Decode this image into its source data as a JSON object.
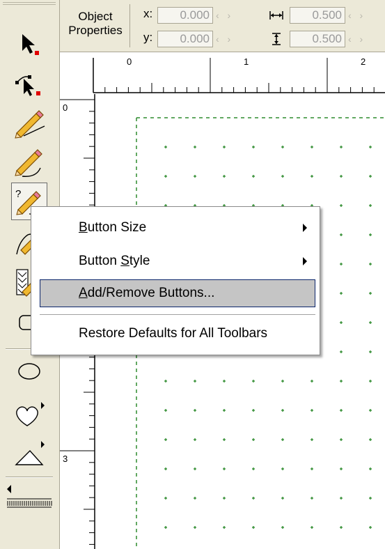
{
  "properties": {
    "title_line1": "Object",
    "title_line2": "Properties",
    "x_label": "x:",
    "y_label": "y:",
    "x_value": "0.000",
    "y_value": "0.000",
    "width_value": "0.500",
    "height_value": "0.500",
    "spin_glyph": "‹ ›"
  },
  "ruler": {
    "h_labels": [
      "0",
      "1",
      "2"
    ],
    "v_labels": [
      "0",
      "3"
    ]
  },
  "tools": [
    {
      "name": "select-tool",
      "icon": "arrow-pointer-icon"
    },
    {
      "name": "node-edit-tool",
      "icon": "node-arrow-icon"
    },
    {
      "name": "freehand-tool",
      "icon": "pencil-line-icon"
    },
    {
      "name": "bezier-tool",
      "icon": "pencil-curve-icon"
    },
    {
      "name": "pen-tool",
      "icon": "pencil-question-icon"
    },
    {
      "name": "calligraphy-tool",
      "icon": "pencil-brush-icon"
    },
    {
      "name": "pattern-tool",
      "icon": "pencil-pattern-icon"
    },
    {
      "name": "rectangle-tool",
      "icon": "rounded-rectangle-icon"
    },
    {
      "name": "ellipse-tool",
      "icon": "ellipse-icon"
    },
    {
      "name": "shape-heart-tool",
      "icon": "heart-icon"
    },
    {
      "name": "shape-triangle-tool",
      "icon": "triangle-icon"
    }
  ],
  "context_menu": {
    "items": [
      {
        "pre": "",
        "key": "B",
        "post": "utton Size",
        "submenu": true
      },
      {
        "pre": "Button ",
        "key": "S",
        "post": "tyle",
        "submenu": true
      },
      {
        "pre": "",
        "key": "A",
        "post": "dd/Remove Buttons...",
        "submenu": false
      },
      {
        "pre": "Restore Defaults for All Toolbars",
        "key": "",
        "post": "",
        "submenu": false
      }
    ]
  },
  "colors": {
    "chrome": "#ece9d8",
    "menu_highlight": "#c5c5c5",
    "menu_border": "#0a246a",
    "grid_dot": "#2e8b2e",
    "tool_marker": "#e00000"
  }
}
